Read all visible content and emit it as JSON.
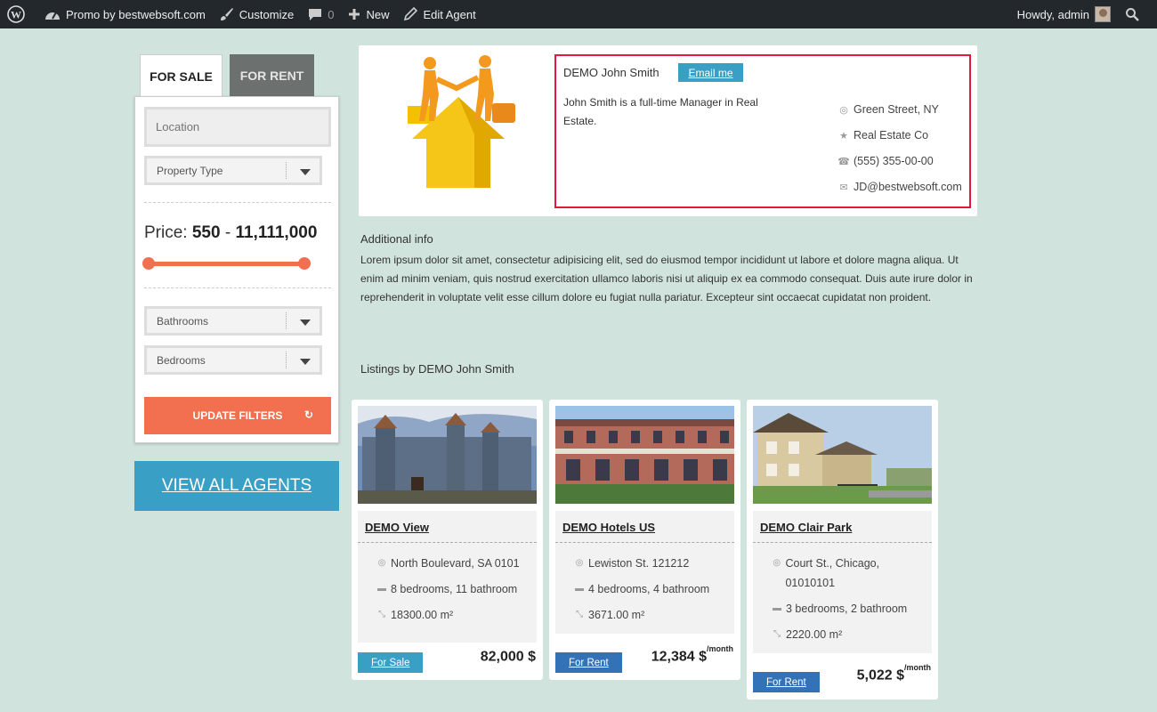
{
  "adminbar": {
    "site": "Promo by bestwebsoft.com",
    "customize": "Customize",
    "comments": "0",
    "new": "New",
    "edit": "Edit Agent",
    "howdy": "Howdy, admin"
  },
  "tabs": {
    "sale": "FOR SALE",
    "rent": "FOR RENT"
  },
  "filters": {
    "location_placeholder": "Location",
    "property_type": "Property Type",
    "price_label": "Price:",
    "price_min": "550",
    "price_sep": "-",
    "price_max": "11,111,000",
    "bathrooms": "Bathrooms",
    "bedrooms": "Bedrooms",
    "update": "UPDATE FILTERS"
  },
  "view_all_agents": "VIEW ALL AGENTS",
  "agent": {
    "name": "DEMO John Smith",
    "email_button": "Email me",
    "description": "John Smith is a full-time Manager in Real Estate.",
    "address": "Green Street, NY",
    "company": "Real Estate Co",
    "phone": "(555) 355-00-00",
    "email": "JD@bestwebsoft.com"
  },
  "additional": {
    "title": "Additional info",
    "text": "Lorem ipsum dolor sit amet, consectetur adipisicing elit, sed do eiusmod tempor incididunt ut labore et dolore magna aliqua. Ut enim ad minim veniam, quis nostrud exercitation ullamco laboris nisi ut aliquip ex ea commodo consequat. Duis aute irure dolor in reprehenderit in voluptate velit esse cillum dolore eu fugiat nulla pariatur. Excepteur sint occaecat cupidatat non proident."
  },
  "listings_title": "Listings by DEMO John Smith",
  "listings": [
    {
      "title": "DEMO View",
      "address": "North Boulevard, SA 0101",
      "rooms": "8 bedrooms, 11 bathroom",
      "area": "18300.00 m²",
      "badge": "For Sale",
      "price": "82,000 $",
      "suffix": ""
    },
    {
      "title": "DEMO Hotels US",
      "address": "Lewiston St. 121212",
      "rooms": "4 bedrooms, 4 bathroom",
      "area": "3671.00 m²",
      "badge": "For Rent",
      "price": "12,384 $",
      "suffix": "/month"
    },
    {
      "title": "DEMO Clair Park",
      "address": "Court St., Chicago, 01010101",
      "rooms": "3 bedrooms, 2 bathroom",
      "area": "2220.00 m²",
      "badge": "For Rent",
      "price": "5,022 $",
      "suffix": "/month"
    }
  ],
  "colors": {
    "accent": "#f26f50",
    "blue": "#3a9fc5",
    "rent_blue": "#3472b8",
    "highlight": "#e4173e",
    "bg": "#d0e3dc"
  },
  "icons": [
    "wordpress-icon",
    "dashboard-icon",
    "brush-icon",
    "comment-icon",
    "plus-icon",
    "pencil-icon",
    "search-icon",
    "globe-icon",
    "pin-icon",
    "phone-icon",
    "mail-icon",
    "bed-icon",
    "resize-icon",
    "refresh-icon"
  ]
}
